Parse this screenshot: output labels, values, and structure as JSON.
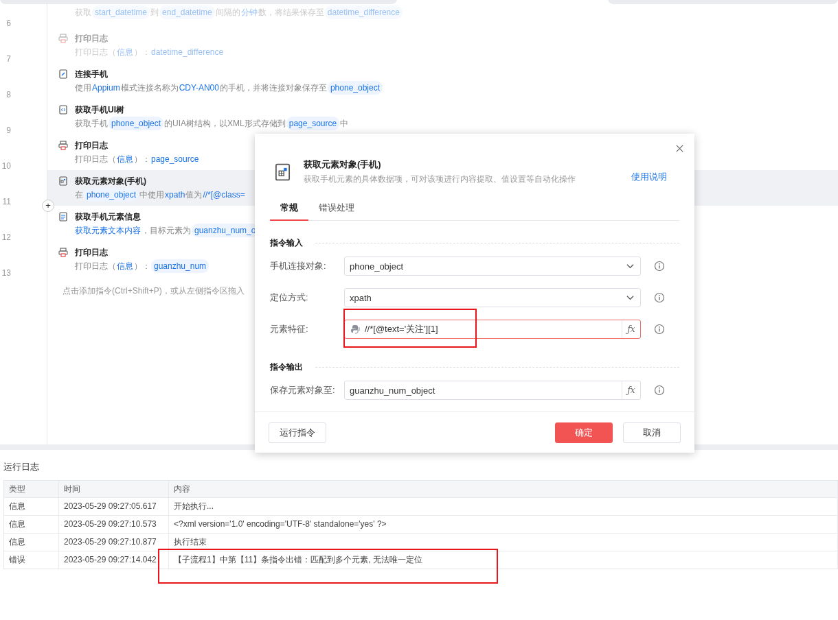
{
  "flow": {
    "rows": [
      {
        "number": "6",
        "disabled": true,
        "selected": false,
        "description": [
          {
            "kind": "plain",
            "text": "获取"
          },
          {
            "kind": "chip",
            "text": "start_datetime"
          },
          {
            "kind": "plain",
            "text": "到"
          },
          {
            "kind": "chip",
            "text": "end_datetime"
          },
          {
            "kind": "plain",
            "text": "间隔的"
          },
          {
            "kind": "link",
            "text": "分钟"
          },
          {
            "kind": "plain",
            "text": "数，将结果保存至"
          },
          {
            "kind": "chip",
            "text": "datetime_difference"
          }
        ]
      },
      {
        "number": "7",
        "kind": "print",
        "disabled": true,
        "selected": false,
        "title": "打印日志",
        "description": [
          {
            "kind": "plain",
            "text": "打印日志（"
          },
          {
            "kind": "link",
            "text": "信息"
          },
          {
            "kind": "plain",
            "text": "）："
          },
          {
            "kind": "link",
            "text": "datetime_difference"
          }
        ]
      },
      {
        "number": "8",
        "kind": "phone",
        "disabled": false,
        "selected": false,
        "title": "连接手机",
        "description": [
          {
            "kind": "plain",
            "text": "使用"
          },
          {
            "kind": "link",
            "text": "Appium"
          },
          {
            "kind": "plain",
            "text": "模式连接名称为"
          },
          {
            "kind": "link",
            "text": "CDY-AN00"
          },
          {
            "kind": "plain",
            "text": "的手机，并将连接对象保存至"
          },
          {
            "kind": "chip",
            "text": "phone_object"
          }
        ]
      },
      {
        "number": "9",
        "kind": "code",
        "disabled": false,
        "selected": false,
        "title": "获取手机UI树",
        "description": [
          {
            "kind": "plain",
            "text": "获取手机"
          },
          {
            "kind": "chip",
            "text": "phone_object"
          },
          {
            "kind": "plain",
            "text": "的UIA树结构，以XML形式存储到"
          },
          {
            "kind": "chip",
            "text": "page_source"
          },
          {
            "kind": "plain",
            "text": "中"
          }
        ]
      },
      {
        "number": "10",
        "kind": "print",
        "disabled": false,
        "selected": false,
        "title": "打印日志",
        "description": [
          {
            "kind": "plain",
            "text": "打印日志（"
          },
          {
            "kind": "link",
            "text": "信息"
          },
          {
            "kind": "plain",
            "text": "）："
          },
          {
            "kind": "link",
            "text": "page_source"
          }
        ]
      },
      {
        "number": "11",
        "kind": "element",
        "disabled": false,
        "selected": true,
        "title": "获取元素对象(手机)",
        "description": [
          {
            "kind": "plain",
            "text": "在"
          },
          {
            "kind": "chip",
            "text": "phone_object"
          },
          {
            "kind": "plain",
            "text": "中使用"
          },
          {
            "kind": "link",
            "text": "xpath"
          },
          {
            "kind": "plain",
            "text": "值为"
          },
          {
            "kind": "link",
            "text": "//*[@class="
          }
        ]
      },
      {
        "number": "12",
        "kind": "text",
        "disabled": false,
        "selected": false,
        "title": "获取手机元素信息",
        "description": [
          {
            "kind": "link",
            "text": "获取元素文本内容"
          },
          {
            "kind": "plain",
            "text": "，目标元素为"
          },
          {
            "kind": "chip",
            "text": "guanzhu_num_o"
          }
        ]
      },
      {
        "number": "13",
        "kind": "print",
        "disabled": false,
        "selected": false,
        "title": "打印日志",
        "description": [
          {
            "kind": "plain",
            "text": "打印日志（"
          },
          {
            "kind": "link",
            "text": "信息"
          },
          {
            "kind": "plain",
            "text": "）："
          },
          {
            "kind": "chip",
            "text": "guanzhu_num"
          }
        ]
      }
    ],
    "add_button": "+",
    "add_hint": "点击添加指令(Ctrl+Shift+P)，或从左侧指令区拖入"
  },
  "dialog": {
    "title": "获取元素对象(手机)",
    "subtitle": "获取手机元素的具体数据项，可对该项进行内容提取、值设置等自动化操作",
    "help_link": "使用说明",
    "tabs": [
      {
        "label": "常规",
        "selected": true
      },
      {
        "label": "错误处理",
        "selected": false
      }
    ],
    "sections": [
      {
        "title": "指令输入",
        "fields": [
          {
            "label": "手机连接对象:",
            "kind": "select",
            "value": "phone_object",
            "invalid": false
          },
          {
            "label": "定位方式:",
            "kind": "select",
            "value": "xpath",
            "invalid": false
          },
          {
            "label": "元素特征:",
            "kind": "code",
            "value": "//*[@text='关注'][1]",
            "invalid": true,
            "action": "ƒx"
          }
        ]
      },
      {
        "title": "指令输出",
        "fields": [
          {
            "label": "保存元素对象至:",
            "kind": "variable",
            "value": "guanzhu_num_object",
            "invalid": false,
            "action": "ƒx"
          }
        ]
      }
    ],
    "buttons": [
      {
        "label": "运行指令",
        "kind": "secondary"
      },
      {
        "label": "确定",
        "kind": "primary"
      },
      {
        "label": "取消",
        "kind": "secondary"
      }
    ]
  },
  "log": {
    "title": "运行日志",
    "columns": [
      "类型",
      "时间",
      "内容"
    ],
    "rows": [
      {
        "type": "信息",
        "time": "2023-05-29 09:27:05.617",
        "content": "开始执行..."
      },
      {
        "type": "信息",
        "time": "2023-05-29 09:27:10.573",
        "content": "<?xml version='1.0' encoding='UTF-8' standalone='yes' ?>"
      },
      {
        "type": "信息",
        "time": "2023-05-29 09:27:10.877",
        "content": "执行结束"
      },
      {
        "type": "错误",
        "time": "2023-05-29 09:27:14.042",
        "content": "【子流程1】中第【11】条指令出错：匹配到多个元素, 无法唯一定位"
      }
    ]
  }
}
